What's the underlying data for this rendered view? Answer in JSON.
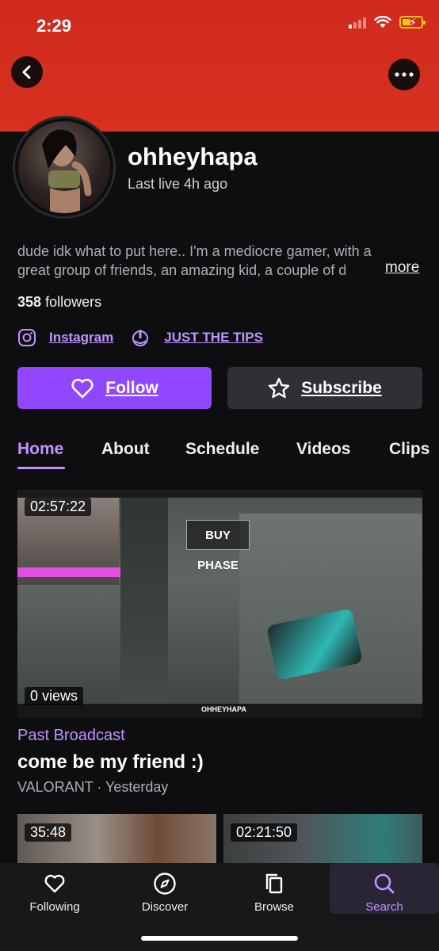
{
  "status_bar": {
    "time": "2:29"
  },
  "channel": {
    "name": "ohheyhapa",
    "last_live": "Last live 4h ago",
    "bio_line1": "dude idk what to put here.. I'm a mediocre gamer, with a",
    "bio_line2": "great group of friends, an amazing kid, a couple of d",
    "more_label": "more",
    "followers_count": "358",
    "followers_label": "followers"
  },
  "social": {
    "instagram_label": "Instagram",
    "tips_label": "JUST THE TIPS"
  },
  "actions": {
    "follow_label": "Follow",
    "subscribe_label": "Subscribe"
  },
  "tabs": [
    "Home",
    "About",
    "Schedule",
    "Videos",
    "Clips"
  ],
  "featured_video": {
    "duration": "02:57:22",
    "views": "0 views",
    "type_label": "Past Broadcast",
    "title": "come be my friend :)",
    "meta": "VALORANT · Yesterday",
    "thumb_text": "BUY PHASE",
    "thumb_overlay": "OHHEYHAPA"
  },
  "more_videos": [
    {
      "duration": "35:48"
    },
    {
      "duration": "02:21:50"
    }
  ],
  "bottom_nav": [
    {
      "label": "Following",
      "icon": "heart-icon"
    },
    {
      "label": "Discover",
      "icon": "compass-icon"
    },
    {
      "label": "Browse",
      "icon": "browse-icon"
    },
    {
      "label": "Search",
      "icon": "search-icon"
    }
  ],
  "colors": {
    "accent": "#9147ff",
    "accent_text": "#bf94ff",
    "header": "#d8311f",
    "background": "#0e0e10"
  }
}
